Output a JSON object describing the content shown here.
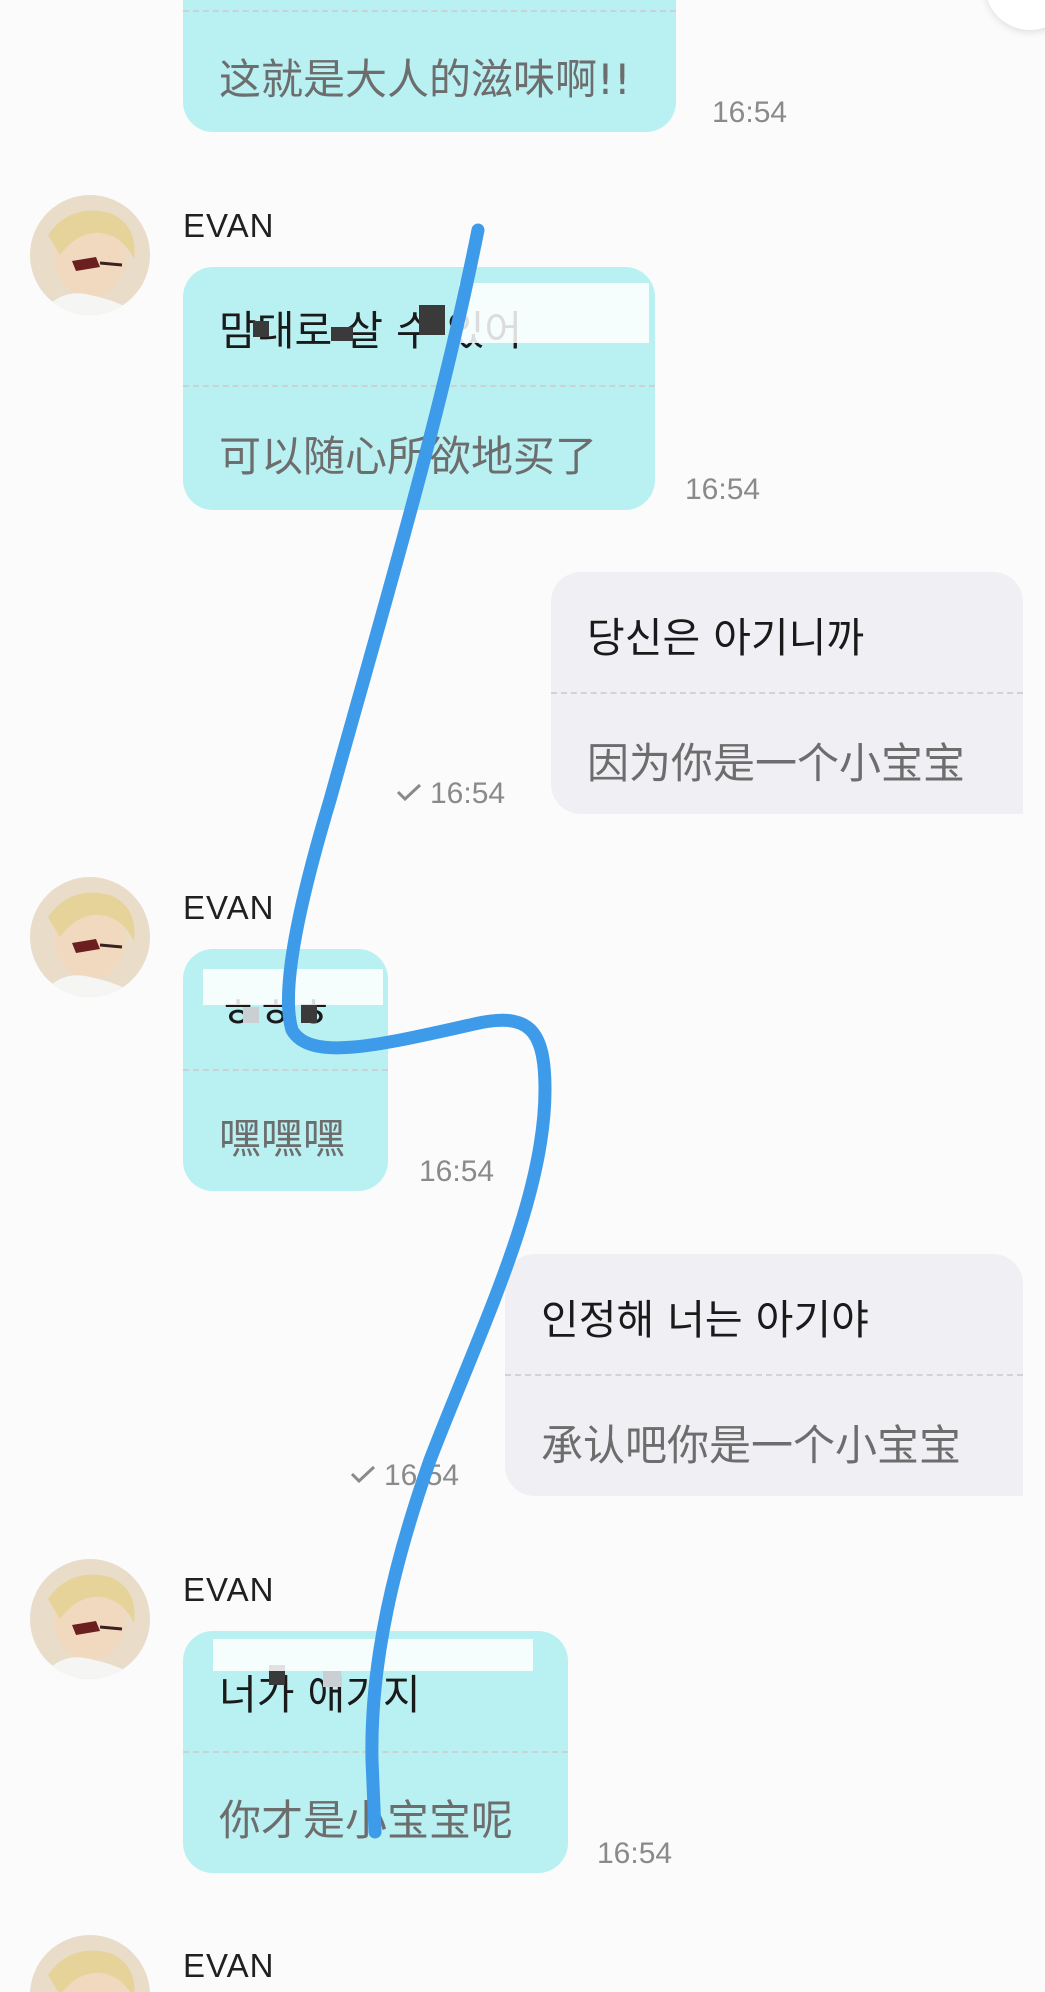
{
  "messages": [
    {
      "translation": "这就是大人的滋味啊!!",
      "time": "16:54"
    },
    {
      "sender": "EVAN",
      "original": "맘대로 살 수 있어",
      "translation": "可以随心所欲地买了",
      "time": "16:54"
    },
    {
      "original": "당신은 아기니까",
      "translation": "因为你是一个小宝宝",
      "time": "16:54"
    },
    {
      "sender": "EVAN",
      "original": "ㅎㅎㅎ",
      "translation": "嘿嘿嘿",
      "time": "16:54"
    },
    {
      "original": "인정해 너는 아기야",
      "translation": "承认吧你是一个小宝宝",
      "time": "16:54"
    },
    {
      "sender": "EVAN",
      "original": "너가 애기지",
      "translation": "你才是小宝宝呢",
      "time": "16:54"
    },
    {
      "sender": "EVAN"
    }
  ],
  "colors": {
    "incoming_bubble": "#b9f0f2",
    "outgoing_bubble": "#f0f0f4",
    "scribble": "#3d9be9"
  },
  "icons": {
    "read_receipt": "check-icon",
    "avatar": "user-avatar-photo"
  }
}
